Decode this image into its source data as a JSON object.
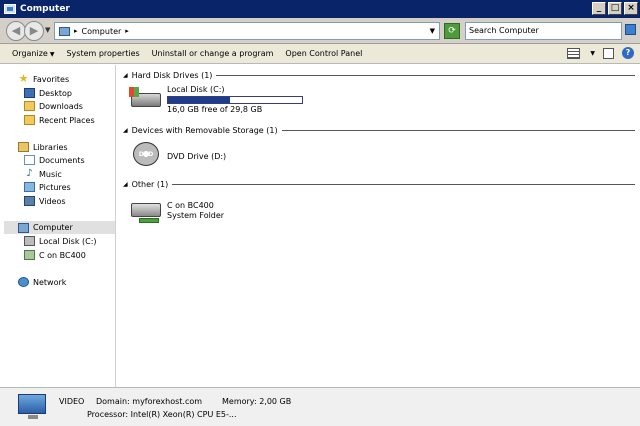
{
  "window": {
    "title": "Computer",
    "buttons": [
      "_",
      "□",
      "×"
    ]
  },
  "address": {
    "path": "Computer",
    "search_placeholder": "Search Computer"
  },
  "toolbar": {
    "organize": "Organize",
    "system_properties": "System properties",
    "uninstall": "Uninstall or change a program",
    "control_panel": "Open Control Panel"
  },
  "nav": {
    "favorites": "Favorites",
    "desktop": "Desktop",
    "downloads": "Downloads",
    "recent": "Recent Places",
    "libraries": "Libraries",
    "documents": "Documents",
    "music": "Music",
    "pictures": "Pictures",
    "videos": "Videos",
    "computer": "Computer",
    "local_disk": "Local Disk (C:)",
    "c_on_bc400": "C on BC400",
    "network": "Network"
  },
  "groups": {
    "hdd": "Hard Disk Drives (1)",
    "removable": "Devices with Removable Storage (1)",
    "other": "Other (1)"
  },
  "items": {
    "local_disk": {
      "name": "Local Disk (C:)",
      "free_text": "16,0 GB free of 29,8 GB",
      "used_fraction": 0.46
    },
    "dvd": {
      "name": "DVD Drive (D:)",
      "badge": "DVD"
    },
    "bc400": {
      "name": "C on BC400",
      "type": "System Folder"
    }
  },
  "details": {
    "name": "VIDEO",
    "domain": "Domain: myforexhost.com",
    "memory": "Memory: 2,00 GB",
    "processor": "Processor: Intel(R) Xeon(R) CPU E5-..."
  },
  "icons": [
    "computer-icon",
    "star-icon",
    "desktop-icon",
    "downloads-icon",
    "recent-places-icon",
    "libraries-icon",
    "documents-icon",
    "music-icon",
    "pictures-icon",
    "videos-icon",
    "hard-disk-icon",
    "network-drive-icon",
    "network-icon",
    "dvd-drive-icon",
    "search-icon",
    "help-icon"
  ]
}
